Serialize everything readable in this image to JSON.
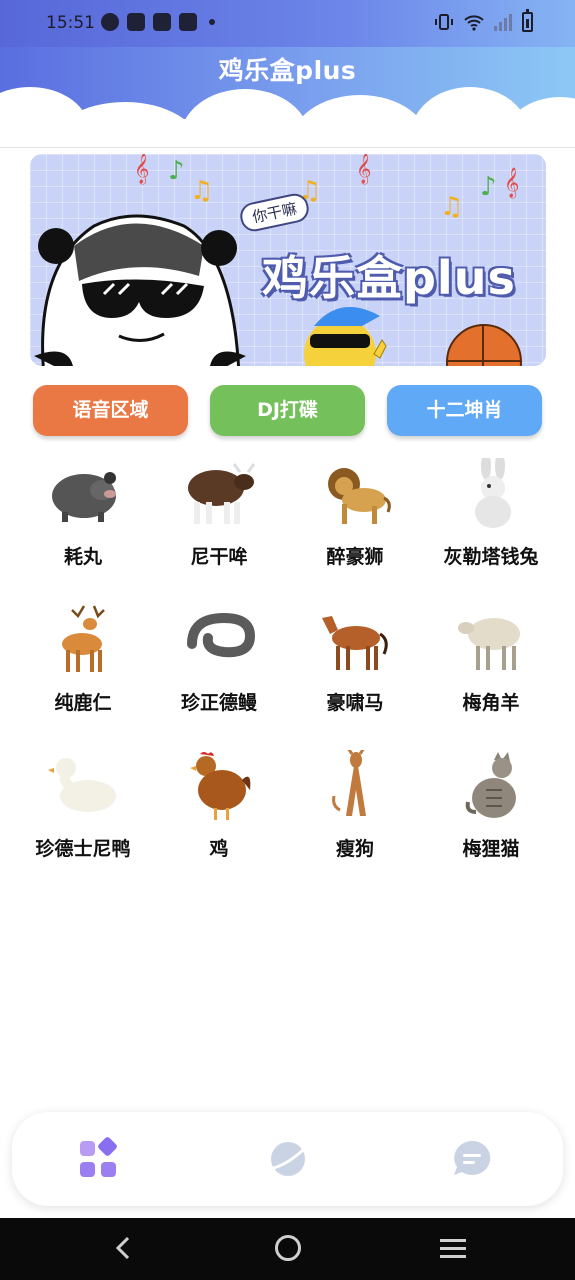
{
  "status_bar": {
    "time": "15:51"
  },
  "header": {
    "title": "鸡乐盒plus"
  },
  "banner": {
    "title": "鸡乐盒plus",
    "bubble_text": "你干嘛"
  },
  "buttons": [
    {
      "label": "语音区域",
      "color": "#ea7844"
    },
    {
      "label": "DJ打碟",
      "color": "#74c05a"
    },
    {
      "label": "十二坤肖",
      "color": "#60a9f7"
    }
  ],
  "animals": [
    {
      "label": "耗丸",
      "icon": "pig-image"
    },
    {
      "label": "尼干哞",
      "icon": "cow-image"
    },
    {
      "label": "醉豪狮",
      "icon": "lion-image"
    },
    {
      "label": "灰勒塔钱兔",
      "icon": "rabbit-image"
    },
    {
      "label": "纯鹿仁",
      "icon": "deer-image"
    },
    {
      "label": "珍正德鳗",
      "icon": "eel-image"
    },
    {
      "label": "豪啸马",
      "icon": "horse-image"
    },
    {
      "label": "梅角羊",
      "icon": "sheep-image"
    },
    {
      "label": "珍德士尼鸭",
      "icon": "duck-image"
    },
    {
      "label": "鸡",
      "icon": "chicken-image"
    },
    {
      "label": "瘦狗",
      "icon": "dog-image"
    },
    {
      "label": "梅狸猫",
      "icon": "cat-image"
    }
  ],
  "bottom_nav": [
    {
      "icon": "apps-grid-icon",
      "active": true
    },
    {
      "icon": "planet-icon",
      "active": false
    },
    {
      "icon": "chat-bubble-icon",
      "active": false
    }
  ],
  "colors": {
    "header_start": "#5a6ee0",
    "header_end": "#8cc8f5",
    "nav_active": "#9b7ef0",
    "nav_inactive": "#c9d3e3"
  }
}
